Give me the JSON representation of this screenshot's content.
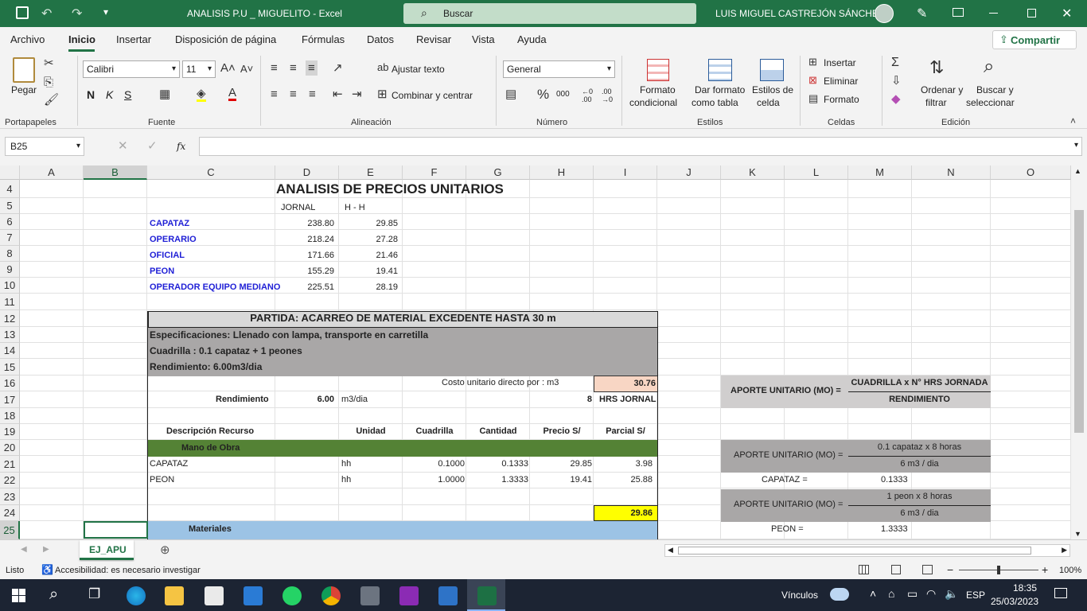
{
  "window": {
    "title": "ANALISIS P.U _ MIGUELITO  -  Excel",
    "search_placeholder": "Buscar",
    "user": "LUIS MIGUEL CASTREJÓN SÁNCHEZ",
    "accent": "#217346"
  },
  "ribbon_tabs": [
    "Archivo",
    "Inicio",
    "Insertar",
    "Disposición de página",
    "Fórmulas",
    "Datos",
    "Revisar",
    "Vista",
    "Ayuda"
  ],
  "share_label": "Compartir",
  "ribbon": {
    "paste": "Pegar",
    "font_name": "Calibri",
    "font_size": "11",
    "bold": "N",
    "italic": "K",
    "underline": "S",
    "wrap_text": "Ajustar texto",
    "merge_center": "Combinar y centrar",
    "number_format": "General",
    "cond_format": [
      "Formato",
      "condicional"
    ],
    "format_table": [
      "Dar formato",
      "como tabla"
    ],
    "cell_styles": [
      "Estilos de",
      "celda"
    ],
    "insert": "Insertar",
    "delete": "Eliminar",
    "format": "Formato",
    "sort_filter": [
      "Ordenar y",
      "filtrar"
    ],
    "find_select": [
      "Buscar y",
      "seleccionar"
    ],
    "groups": [
      "Portapapeles",
      "Fuente",
      "Alineación",
      "Número",
      "Estilos",
      "Celdas",
      "Edición"
    ]
  },
  "formula_bar": {
    "name_box": "B25",
    "fx": "fx",
    "value": ""
  },
  "columns": [
    "A",
    "B",
    "C",
    "D",
    "E",
    "F",
    "G",
    "H",
    "I",
    "J",
    "K",
    "L",
    "M",
    "N",
    "O"
  ],
  "rows": [
    "4",
    "5",
    "6",
    "7",
    "8",
    "9",
    "10",
    "11",
    "12",
    "13",
    "14",
    "15",
    "16",
    "17",
    "18",
    "19",
    "20",
    "21",
    "22",
    "23",
    "24",
    "25"
  ],
  "sheet": {
    "title": "ANALISIS DE PRECIOS UNITARIOS",
    "jornal_hdr": "JORNAL",
    "hh_hdr": "H - H",
    "workers": [
      {
        "name": "CAPATAZ",
        "jornal": "238.80",
        "hh": "29.85"
      },
      {
        "name": "OPERARIO",
        "jornal": "218.24",
        "hh": "27.28"
      },
      {
        "name": "OFICIAL",
        "jornal": "171.66",
        "hh": "21.46"
      },
      {
        "name": "PEON",
        "jornal": "155.29",
        "hh": "19.41"
      },
      {
        "name": "OPERADOR EQUIPO MEDIANO",
        "jornal": "225.51",
        "hh": "28.19"
      }
    ],
    "partida": "PARTIDA: ACARREO DE MATERIAL EXCEDENTE HASTA 30 m",
    "spec": "Especificaciones: Llenado con lampa, transporte en carretilla",
    "cuadrilla": "Cuadrilla :   0.1 capataz + 1 peones",
    "rendimiento_txt": "Rendimiento:     6.00m3/dia",
    "costo_label": "Costo unitario directo por : m3",
    "costo_value": "30.76",
    "rend_label": "Rendimiento",
    "rend_value": "6.00",
    "rend_unit": "m3/dia",
    "jornada_hrs": "8",
    "jornada_label": "HRS JORNAL",
    "headers": [
      "Descripción Recurso",
      "Unidad",
      "Cuadrilla",
      "Cantidad",
      "Precio S/",
      "Parcial S/"
    ],
    "mano_obra": "Mano de Obra",
    "mo_rows": [
      {
        "desc": "CAPATAZ",
        "unit": "hh",
        "cuad": "0.1000",
        "cant": "0.1333",
        "precio": "29.85",
        "parcial": "3.98"
      },
      {
        "desc": "PEON",
        "unit": "hh",
        "cuad": "1.0000",
        "cant": "1.3333",
        "precio": "19.41",
        "parcial": "25.88"
      }
    ],
    "mo_total": "29.86",
    "materiales": "Materiales",
    "aporte_label": "APORTE UNITARIO (MO) =",
    "aporte_num": "CUADRILLA x N° HRS JORNADA",
    "aporte_den": "RENDIMIENTO",
    "aporte2_label": "APORTE UNITARIO (MO) =",
    "aporte2_num": "0.1 capataz x 8 horas",
    "aporte2_den": "6 m3 / dia",
    "capataz_lbl": "CAPATAZ =",
    "capataz_val": "0.1333",
    "aporte3_label": "APORTE UNITARIO (MO) =",
    "aporte3_num": "1 peon x 8 horas",
    "aporte3_den": "6 m3 / dia",
    "peon_lbl": "PEON =",
    "peon_val": "1.3333"
  },
  "sheet_tab": "EJ_APU",
  "status": {
    "ready": "Listo",
    "accessibility": "Accesibilidad: es necesario investigar",
    "zoom": "100%"
  },
  "taskbar": {
    "vinculos": "Vínculos",
    "lang": "ESP",
    "time": "18:35",
    "date": "25/03/2023"
  }
}
